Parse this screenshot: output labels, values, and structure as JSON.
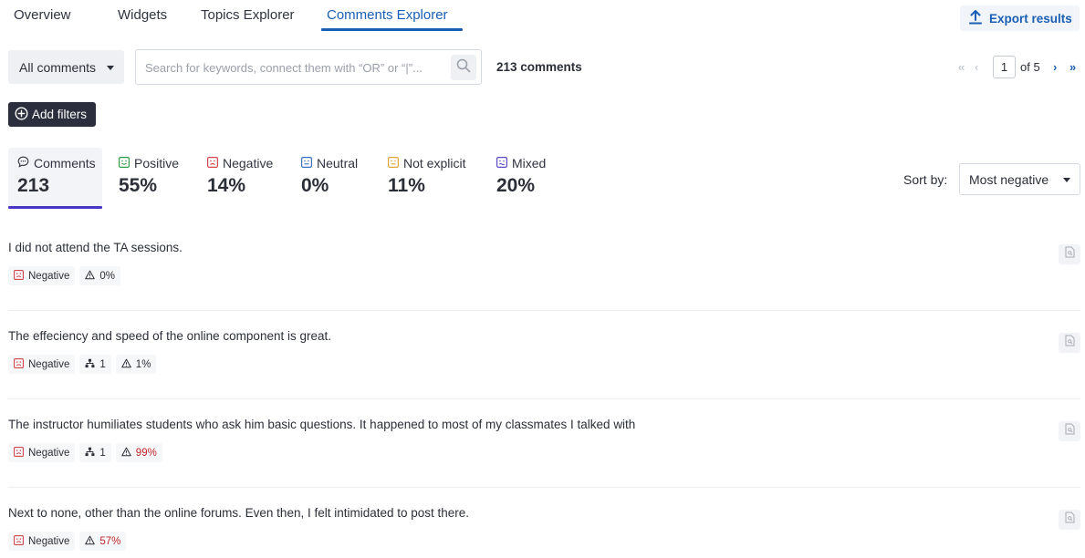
{
  "nav": {
    "tabs": [
      {
        "label": "Overview"
      },
      {
        "label": "Widgets"
      },
      {
        "label": "Topics Explorer"
      },
      {
        "label": "Comments Explorer"
      }
    ],
    "active_tab": "Comments Explorer",
    "export_label": "Export results"
  },
  "toolbar": {
    "filter_dropdown": "All comments",
    "search_placeholder": "Search for keywords, connect them with “OR” or “|”...",
    "search_value": "",
    "count_label": "213 comments",
    "add_filters_label": "Add filters"
  },
  "pagination": {
    "first": "«",
    "prev": "‹",
    "current": "1",
    "of_label": "of 5",
    "next": "›",
    "last": "»"
  },
  "stats": [
    {
      "label": "Comments",
      "value": "213",
      "icon": "speech-bubble-icon"
    },
    {
      "label": "Positive",
      "value": "55%",
      "icon": "positive-face-icon",
      "color": "#2e9a4a"
    },
    {
      "label": "Negative",
      "value": "14%",
      "icon": "negative-face-icon",
      "color": "#d3474d"
    },
    {
      "label": "Neutral",
      "value": "0%",
      "icon": "neutral-face-icon",
      "color": "#3b6fc4"
    },
    {
      "label": "Not explicit",
      "value": "11%",
      "icon": "not-explicit-face-icon",
      "color": "#e0a43a"
    },
    {
      "label": "Mixed",
      "value": "20%",
      "icon": "mixed-face-icon",
      "color": "#5b4bc7"
    }
  ],
  "sort": {
    "label": "Sort by:",
    "value": "Most negative"
  },
  "comments": [
    {
      "text": "I did not attend the TA sessions.",
      "sentiment": "Negative",
      "topics": null,
      "risk": "0%"
    },
    {
      "text": "The effeciency and speed of the online component is great.",
      "sentiment": "Negative",
      "topics": "1",
      "risk": "1%"
    },
    {
      "text": "The instructor humiliates students who ask him basic questions. It happened to most of my classmates I talked with",
      "sentiment": "Negative",
      "topics": "1",
      "risk": "99%"
    },
    {
      "text": "Next to none, other than the online forums. Even then, I felt intimidated to post there.",
      "sentiment": "Negative",
      "topics": null,
      "risk": "57%"
    }
  ],
  "colors": {
    "accent": "#1a5fb4",
    "stat_underline": "#4936c6",
    "negative": "#d3474d",
    "risk_high": "#c0282d"
  }
}
